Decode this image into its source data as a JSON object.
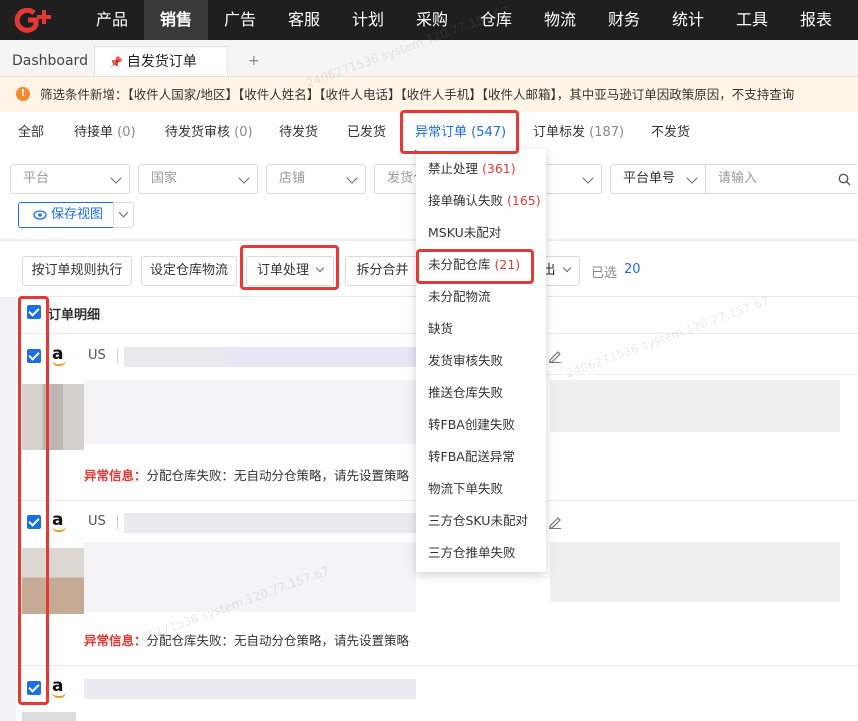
{
  "nav": {
    "items": [
      "产品",
      "销售",
      "广告",
      "客服",
      "计划",
      "采购",
      "仓库",
      "物流",
      "财务",
      "统计",
      "工具",
      "报表"
    ],
    "active_index": 1
  },
  "page_tabs": {
    "dashboard": "Dashboard",
    "current": "自发货订单",
    "add": "+"
  },
  "notice": {
    "text": "筛选条件新增：【收件人国家/地区】【收件人姓名】【收件人电话】【收件人手机】【收件人邮箱】，其中亚马逊订单因政策原因，不支持查询"
  },
  "status_tabs": [
    {
      "label": "全部",
      "count": ""
    },
    {
      "label": "待接单",
      "count": "(0)"
    },
    {
      "label": "待发货审核",
      "count": "(0)"
    },
    {
      "label": "待发货",
      "count": ""
    },
    {
      "label": "已发货",
      "count": ""
    },
    {
      "label": "异常订单",
      "count": "(547)"
    },
    {
      "label": "订单标发",
      "count": "(187)"
    },
    {
      "label": "不发货",
      "count": ""
    }
  ],
  "filters": {
    "platform": "平台",
    "country": "国家",
    "store": "店铺",
    "ship_wh": "发货仓",
    "platform_order_no": "平台单号",
    "input_placeholder": "请输入",
    "save_view": "保存视图"
  },
  "toolbar": {
    "rule_execute": "按订单规则执行",
    "set_wh_logistics": "设定仓库物流",
    "order_process": "订单处理",
    "split_merge": "拆分合并",
    "export_partial": "出",
    "selected_label": "已选",
    "selected_count": "20"
  },
  "list": {
    "header": "订单明细",
    "orders": [
      {
        "country": "US",
        "err_label": "异常信息：",
        "err_text": "分配仓库失败：无自动分仓策略，请先设置策略"
      },
      {
        "country": "US",
        "err_label": "异常信息：",
        "err_text": "分配仓库失败：无自动分仓策略，请先设置策略"
      }
    ]
  },
  "dropdown": {
    "items": [
      {
        "label": "禁止处理",
        "count": "(361)"
      },
      {
        "label": "接单确认失败",
        "count": "(165)"
      },
      {
        "label": "MSKU未配对",
        "count": ""
      },
      {
        "label": "未分配仓库",
        "count": "(21)"
      },
      {
        "label": "未分配物流",
        "count": ""
      },
      {
        "label": "缺货",
        "count": ""
      },
      {
        "label": "发货审核失败",
        "count": ""
      },
      {
        "label": "推送仓库失败",
        "count": ""
      },
      {
        "label": "转FBA创建失败",
        "count": ""
      },
      {
        "label": "转FBA配送异常",
        "count": ""
      },
      {
        "label": "物流下单失败",
        "count": ""
      },
      {
        "label": "三方仓SKU未配对",
        "count": ""
      },
      {
        "label": "三方仓推单失败",
        "count": ""
      }
    ]
  },
  "colors": {
    "accent": "#1a6ee6",
    "error": "#e53935",
    "nav_bg": "#1f1f1f",
    "notice_bg": "#fff4e6"
  }
}
